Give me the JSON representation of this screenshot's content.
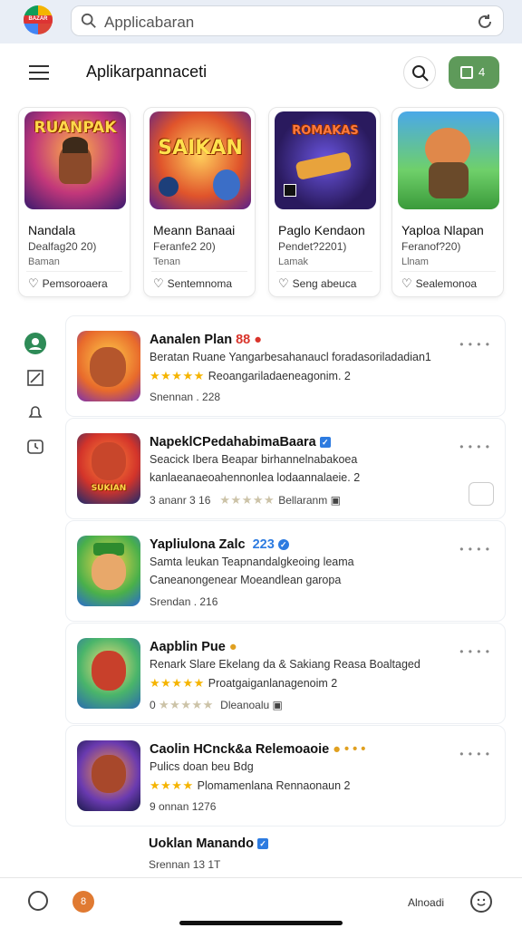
{
  "topbar": {
    "logo_text": "BAZAR",
    "search_value": "Applicabaran"
  },
  "header": {
    "title": "Aplikarpannaceti",
    "action_label": "4"
  },
  "cards": [
    {
      "art_text": "RUANPAK",
      "title": "Nandala",
      "subtitle": "Dealfag20 20)",
      "meta": "Baman",
      "wishlist": "Pemsoroaera",
      "bg": "#6a2a9a"
    },
    {
      "art_text": "SAIKAN",
      "title": "Meann Banaai",
      "subtitle": "Feranfe2 20)",
      "meta": "Tenan",
      "wishlist": "Sentemnoma",
      "bg": "#c4352b"
    },
    {
      "art_text": "ROMAKAS",
      "title": "Paglo Kendaon",
      "subtitle": "Pendet?2201)",
      "meta": "Lamak",
      "wishlist": "Seng abeuca",
      "bg": "#3b1f6b"
    },
    {
      "art_text": "",
      "title": "Yaploa Nlapan",
      "subtitle": "Feranof?20)",
      "meta": "Llnam",
      "wishlist": "Sealemonoa",
      "bg": "#3aa03a"
    }
  ],
  "list": [
    {
      "title": "Aanalen Plan",
      "badge": "88",
      "desc": "Beratan Ruane Yangarbesahanaucl foradasoriladadian1",
      "stars": "★★★★★",
      "line3": "Reoangariladaeneagonim. 2",
      "line4": "Snennan . 228",
      "verified": false
    },
    {
      "title": "NapeklCPedahabimaBaara",
      "badge": "",
      "desc": "Seacick Ibera Beapar birhannelnabakoea",
      "stars": "",
      "line3": "kanlaeanaeoahennonlea lodaannalaeie. 2",
      "line4": "3 ananr 3 16",
      "line4b": "Bellaranm",
      "verified": true
    },
    {
      "title": "Yapliulona Zalc",
      "badge": "223",
      "desc": "Samta leukan Teapnandalgkeoing leama",
      "stars": "",
      "line3": "Caneanongenear Moeandlean garopa",
      "line4": "Srendan . 216",
      "verified": true
    },
    {
      "title": "Aapblin Pue",
      "badge": "",
      "desc": "Renark Slare Ekelang da & Sakiang Reasa Boaltaged",
      "stars": "★★★★★",
      "line3": "Proatgaiganlanagenoim 2",
      "line4": "0",
      "line4b": "Dleanoalu",
      "verified": false
    },
    {
      "title": "Caolin HCnck&a Relemoaoie",
      "badge": "",
      "desc": "Pulics doan beu Bdg",
      "stars": "★★★★",
      "line3": "Plomamenlana Rennaonaun 2",
      "line4": "9 onnan 1276",
      "verified": false
    },
    {
      "title": "Uoklan Manando",
      "badge": "",
      "desc": "",
      "stars": "",
      "line3": "",
      "line4": "Srennan 13 1T",
      "verified": true
    }
  ],
  "bottombar": {
    "label": "Alnoadi",
    "badge": "8"
  }
}
